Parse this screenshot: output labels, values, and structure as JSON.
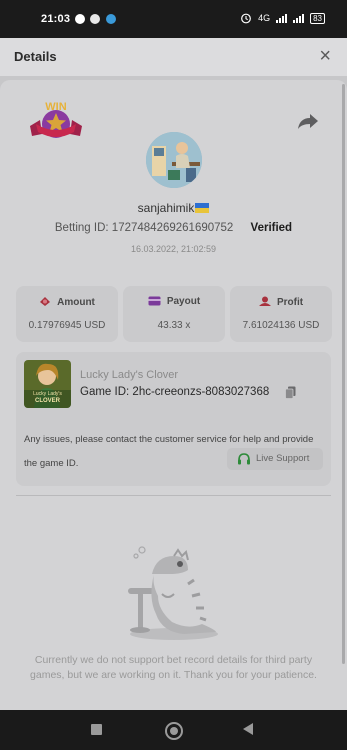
{
  "status_bar": {
    "time": "21:03",
    "network": "4G",
    "battery": "83"
  },
  "header": {
    "title": "Details",
    "close_glyph": "×"
  },
  "bet": {
    "username": "sanjahimik",
    "betting_id_label": "Betting ID:",
    "betting_id": "1727484269261690752",
    "verified": "Verified",
    "date": "16.03.2022, 21:02:59"
  },
  "stats": {
    "amount": {
      "label": "Amount",
      "value": "0.17976945 USD"
    },
    "payout": {
      "label": "Payout",
      "value": "43.33 x"
    },
    "profit": {
      "label": "Profit",
      "value": "7.61024136 USD"
    }
  },
  "game": {
    "name": "Lucky Lady's Clover",
    "id_label": "Game ID:",
    "id": "2hc-creeonzs-8083027368",
    "thumb_text_1": "Lucky Lady's",
    "thumb_text_2": "CLOVER",
    "issue_text": "Any issues, please contact the customer service for help and provide the game ID.",
    "support_label": "Live Support"
  },
  "logo_text": "WIN",
  "empty_message": "Currently we do not support bet record details for third party games, but we are working on it. Thank you for your patience.",
  "colors": {
    "payout_icon": "#7b3a9a",
    "amount_icon": "#a8323e",
    "profit_icon": "#a8323e",
    "support_icon": "#2e8b3a"
  },
  "icons": [
    "win-logo-icon",
    "share-icon",
    "close-icon",
    "amount-icon",
    "payout-icon",
    "profit-icon",
    "copy-icon",
    "headset-icon",
    "alarm-icon",
    "signal-icon",
    "battery-icon"
  ]
}
